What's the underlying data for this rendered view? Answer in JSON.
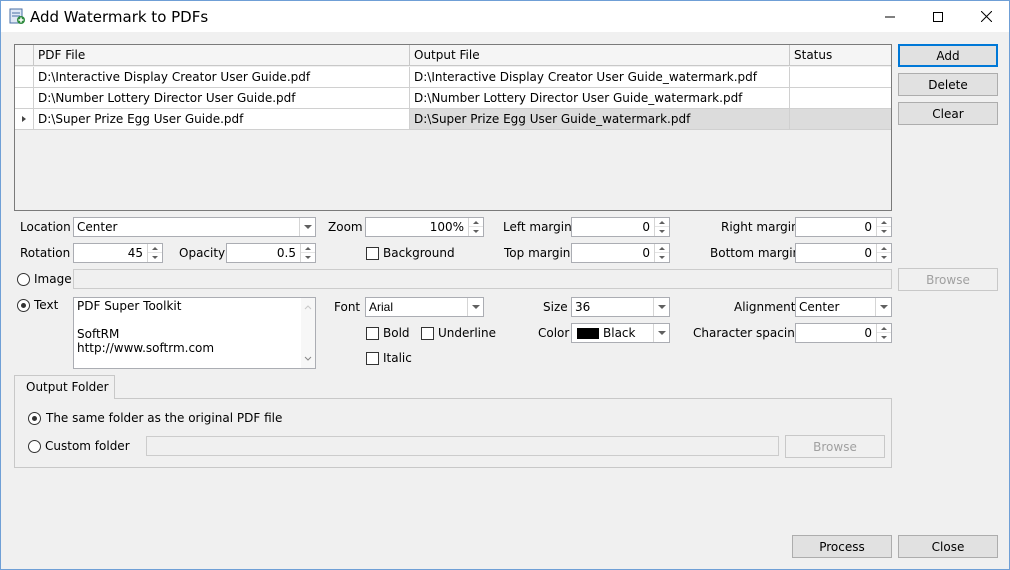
{
  "window": {
    "title": "Add Watermark to PDFs",
    "icon": "pdf-watermark-app-icon"
  },
  "grid": {
    "columns": [
      "PDF File",
      "Output File",
      "Status"
    ],
    "rows": [
      {
        "pdf": "D:\\Interactive Display Creator User Guide.pdf",
        "output": "D:\\Interactive Display Creator User Guide_watermark.pdf",
        "status": ""
      },
      {
        "pdf": "D:\\Number Lottery Director User Guide.pdf",
        "output": "D:\\Number Lottery Director User Guide_watermark.pdf",
        "status": ""
      },
      {
        "pdf": "D:\\Super Prize Egg User Guide.pdf",
        "output": "D:\\Super Prize Egg User Guide_watermark.pdf",
        "status": ""
      }
    ]
  },
  "side_buttons": {
    "add": "Add",
    "delete": "Delete",
    "clear": "Clear"
  },
  "settings": {
    "location_label": "Location",
    "location_value": "Center",
    "zoom_label": "Zoom",
    "zoom_value": "100%",
    "left_margin_label": "Left margin",
    "left_margin_value": "0",
    "right_margin_label": "Right margin",
    "right_margin_value": "0",
    "rotation_label": "Rotation",
    "rotation_value": "45",
    "opacity_label": "Opacity",
    "opacity_value": "0.5",
    "background_label": "Background",
    "top_margin_label": "Top margin",
    "top_margin_value": "0",
    "bottom_margin_label": "Bottom margin",
    "bottom_margin_value": "0"
  },
  "image": {
    "label": "Image",
    "path": "",
    "browse": "Browse"
  },
  "text": {
    "label": "Text",
    "lines": [
      "PDF Super Toolkit",
      "",
      "SoftRM",
      "http://www.softrm.com"
    ]
  },
  "font": {
    "font_label": "Font",
    "font_value": "Arial",
    "bold_label": "Bold",
    "underline_label": "Underline",
    "italic_label": "Italic",
    "size_label": "Size",
    "size_value": "36",
    "color_label": "Color",
    "color_value": "Black",
    "color_hex": "#000000",
    "alignment_label": "Alignment",
    "alignment_value": "Center",
    "char_spacing_label": "Character spacing",
    "char_spacing_value": "0"
  },
  "output": {
    "tab_label": "Output Folder",
    "same_folder_label": "The same folder as the original PDF file",
    "custom_folder_label": "Custom folder",
    "custom_path": "",
    "browse": "Browse"
  },
  "footer": {
    "process": "Process",
    "close": "Close"
  }
}
